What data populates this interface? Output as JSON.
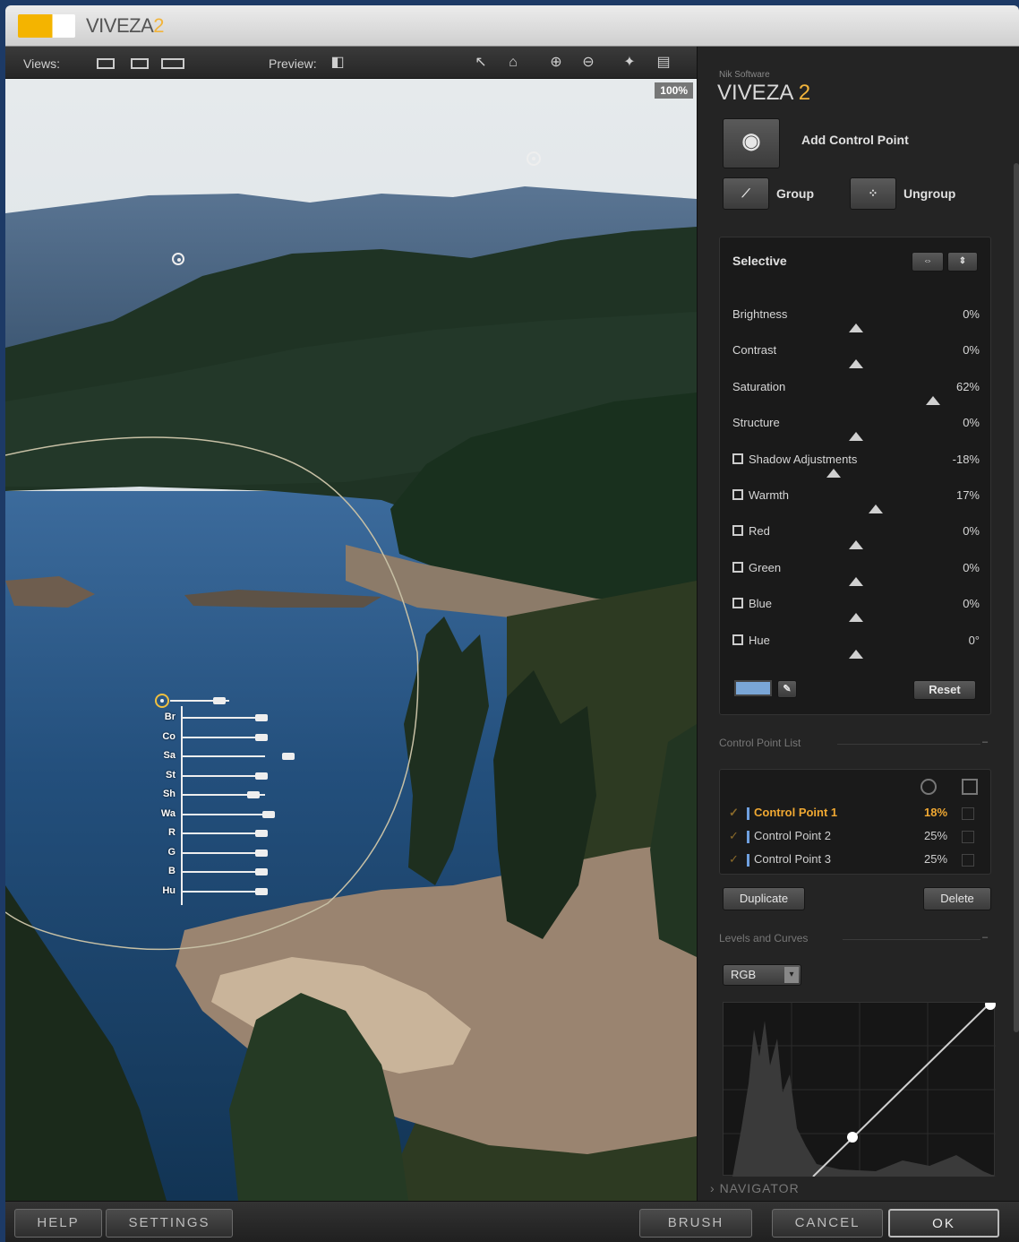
{
  "window": {
    "title": "VIVEZA",
    "title_version": "2"
  },
  "toolbar": {
    "views_label": "Views:",
    "preview_label": "Preview:",
    "zoom": "100%"
  },
  "canvas": {
    "cp_sliders": [
      {
        "label": "Br",
        "value": 0
      },
      {
        "label": "Co",
        "value": 0
      },
      {
        "label": "Sa",
        "value": 62
      },
      {
        "label": "St",
        "value": 0
      },
      {
        "label": "Sh",
        "value": -18
      },
      {
        "label": "Wa",
        "value": 17
      },
      {
        "label": "R",
        "value": 0
      },
      {
        "label": "G",
        "value": 0
      },
      {
        "label": "B",
        "value": 0
      },
      {
        "label": "Hu",
        "value": 0
      }
    ]
  },
  "panel": {
    "brand_small": "Nik Software",
    "brand_name": "VIVEZA",
    "brand_version": "2",
    "add_control_point": "Add Control Point",
    "group": "Group",
    "ungroup": "Ungroup",
    "selective": {
      "title": "Selective",
      "sliders": [
        {
          "name": "Brightness",
          "value": "0%",
          "pos": 0.5,
          "icon": false
        },
        {
          "name": "Contrast",
          "value": "0%",
          "pos": 0.5,
          "icon": false
        },
        {
          "name": "Saturation",
          "value": "62%",
          "pos": 0.81,
          "icon": false
        },
        {
          "name": "Structure",
          "value": "0%",
          "pos": 0.5,
          "icon": false
        },
        {
          "name": "Shadow Adjustments",
          "value": "-18%",
          "pos": 0.41,
          "icon": true
        },
        {
          "name": "Warmth",
          "value": "17%",
          "pos": 0.58,
          "icon": true
        },
        {
          "name": "Red",
          "value": "0%",
          "pos": 0.5,
          "icon": true
        },
        {
          "name": "Green",
          "value": "0%",
          "pos": 0.5,
          "icon": true
        },
        {
          "name": "Blue",
          "value": "0%",
          "pos": 0.5,
          "icon": true
        },
        {
          "name": "Hue",
          "value": "0°",
          "pos": 0.5,
          "icon": true
        }
      ],
      "reset": "Reset"
    },
    "cp_list": {
      "title": "Control Point List",
      "items": [
        {
          "name": "Control Point 1",
          "value": "18%",
          "selected": true
        },
        {
          "name": "Control Point 2",
          "value": "25%",
          "selected": false
        },
        {
          "name": "Control Point 3",
          "value": "25%",
          "selected": false
        }
      ],
      "duplicate": "Duplicate",
      "delete": "Delete"
    },
    "levels": {
      "title": "Levels and Curves",
      "channel": "RGB"
    },
    "navigator": "NAVIGATOR"
  },
  "bottom": {
    "help": "HELP",
    "settings": "SETTINGS",
    "brush": "BRUSH",
    "cancel": "CANCEL",
    "ok": "OK"
  },
  "colors": {
    "accent": "#f2b43b",
    "selected": "#f0a832"
  }
}
